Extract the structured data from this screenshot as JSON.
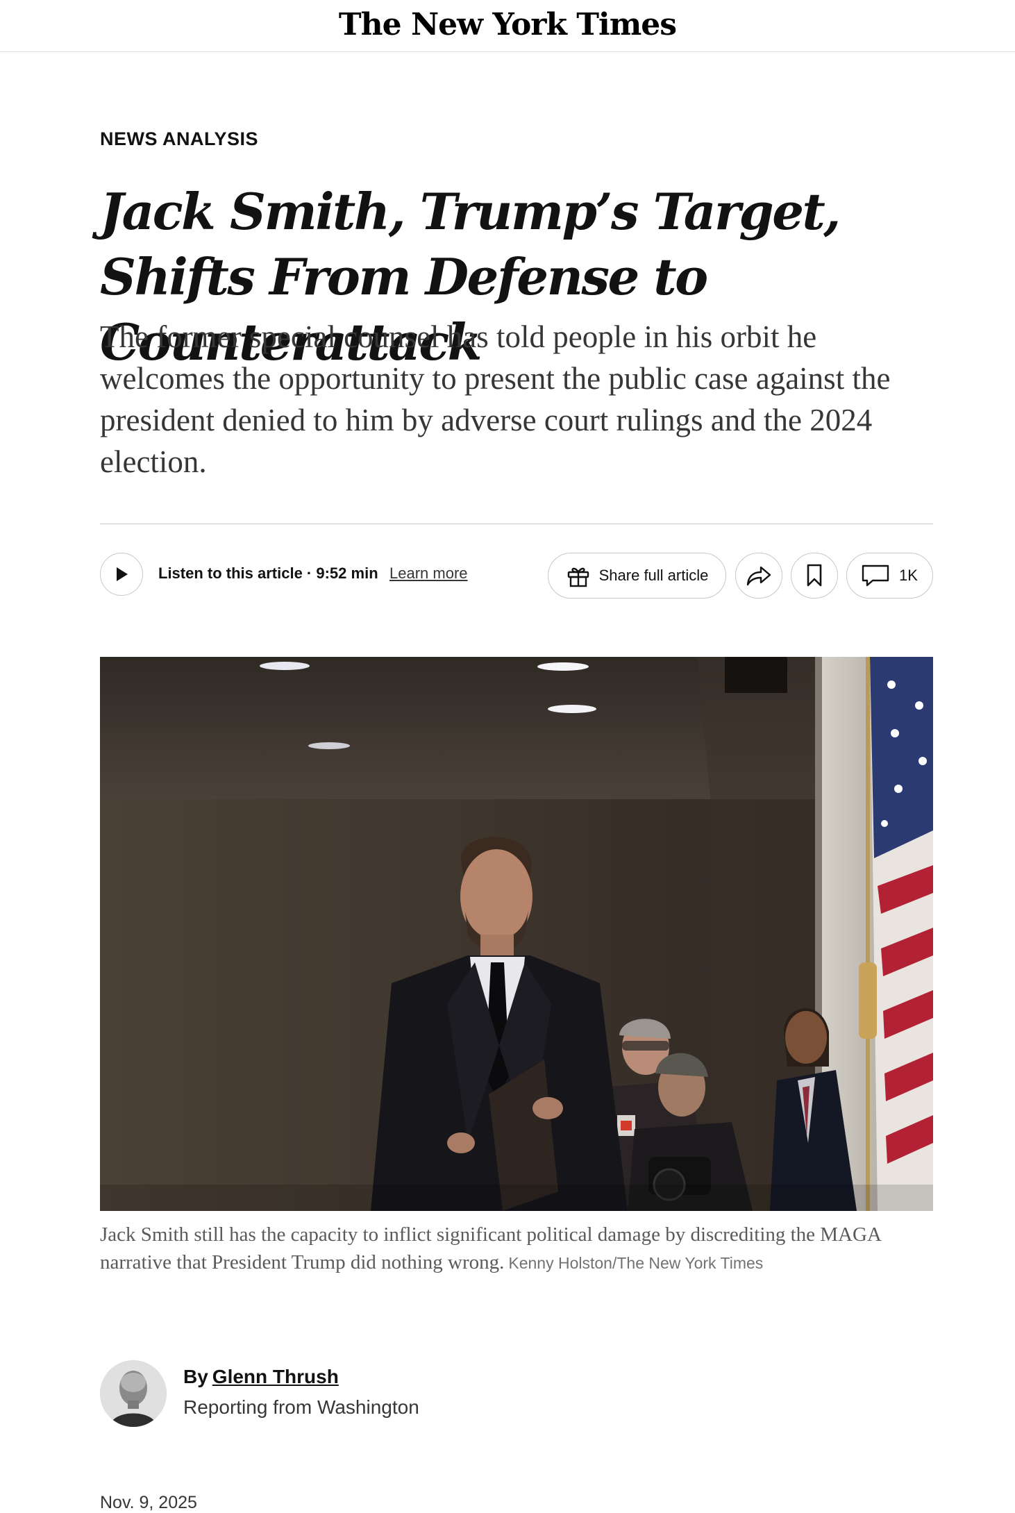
{
  "masthead": {
    "logo": "The New York Times"
  },
  "article": {
    "kicker": "NEWS ANALYSIS",
    "headline": "Jack Smith, Trump’s Target, Shifts From Defense to Counterattack",
    "summary": "The former special counsel has told people in his orbit he welcomes the opportunity to present the public case against the president denied to him by adverse court rulings and the 2024 election."
  },
  "toolbar": {
    "listen_label": "Listen to this article · 9:52 min",
    "learn_more": "Learn more",
    "share_full": "Share full article",
    "comment_count": "1K",
    "icons": [
      "play-icon",
      "gift-icon",
      "share-arrow-icon",
      "bookmark-icon",
      "comment-icon"
    ]
  },
  "photo": {
    "caption": "Jack Smith still has the capacity to inflict significant political damage by discrediting the MAGA narrative that President Trump did nothing wrong.",
    "credit": "Kenny Holston/The New York Times"
  },
  "byline": {
    "by": "By",
    "author": "Glenn Thrush",
    "reporting": "Reporting from Washington",
    "date": "Nov. 9, 2025"
  }
}
